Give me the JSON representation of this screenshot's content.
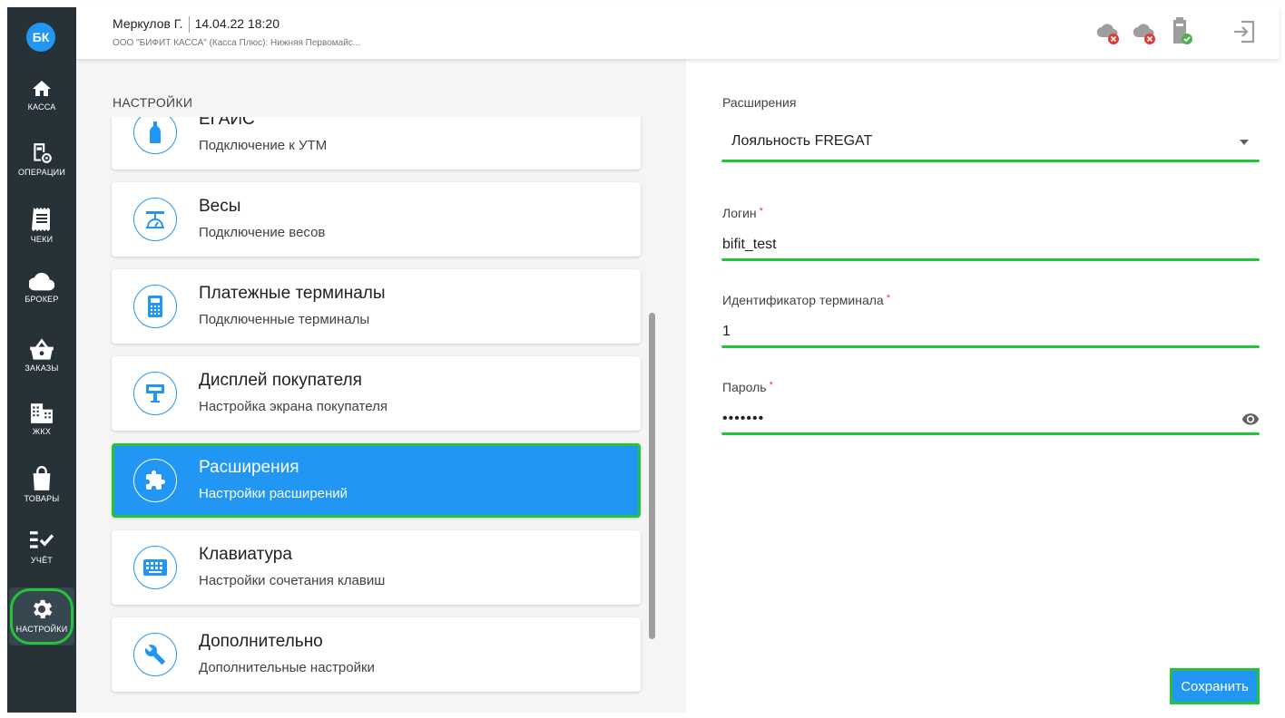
{
  "sidebar": {
    "avatar_initials": "БК",
    "items": [
      {
        "label": "КАССА",
        "icon": "home-icon"
      },
      {
        "label": "ОПЕРАЦИИ",
        "icon": "operations-icon"
      },
      {
        "label": "ЧЕКИ",
        "icon": "receipt-icon"
      },
      {
        "label": "БРОКЕР",
        "icon": "cloud-icon"
      },
      {
        "label": "ЗАКАЗЫ",
        "icon": "basket-icon"
      },
      {
        "label": "ЖКХ",
        "icon": "building-icon"
      },
      {
        "label": "ТОВАРЫ",
        "icon": "shopping-bag-icon"
      },
      {
        "label": "УЧЁТ",
        "icon": "checklist-icon"
      },
      {
        "label": "НАСТРОЙКИ",
        "icon": "gear-icon"
      }
    ],
    "active_item": "НАСТРОЙКИ"
  },
  "header": {
    "user": "Меркулов Г.",
    "datetime": "14.04.22 18:20",
    "org": "ООО \"БИФИТ КАССА\" (Касса Плюс): Нижняя Первомайс...",
    "status_icons": [
      "cloud-error-icon",
      "cloud-error-icon",
      "battery-ok-icon",
      "logout-icon"
    ]
  },
  "settings": {
    "title": "НАСТРОЙКИ",
    "items": [
      {
        "title": "ЕГАИС",
        "subtitle": "Подключение к УТМ",
        "icon": "bottle-icon"
      },
      {
        "title": "Весы",
        "subtitle": "Подключение весов",
        "icon": "scales-icon"
      },
      {
        "title": "Платежные терминалы",
        "subtitle": "Подключенные терминалы",
        "icon": "calculator-icon"
      },
      {
        "title": "Дисплей покупателя",
        "subtitle": "Настройка экрана покупателя",
        "icon": "display-icon"
      },
      {
        "title": "Расширения",
        "subtitle": "Настройки расширений",
        "icon": "puzzle-icon"
      },
      {
        "title": "Клавиатура",
        "subtitle": "Настройки сочетания клавиш",
        "icon": "keyboard-icon"
      },
      {
        "title": "Дополнительно",
        "subtitle": "Дополнительные настройки",
        "icon": "wrench-icon"
      }
    ],
    "selected": "Расширения"
  },
  "form": {
    "extension_label": "Расширения",
    "extension_value": "Лояльность FREGAT",
    "login_label": "Логин",
    "login_value": "bifit_test",
    "terminal_label": "Идентификатор терминала",
    "terminal_value": "1",
    "password_label": "Пароль",
    "password_value": "•••••••",
    "required_mark": "*",
    "save_label": "Сохранить"
  },
  "colors": {
    "sidebar_bg": "#263238",
    "accent": "#2196f3",
    "highlight": "#22c43a",
    "error": "#e53935"
  }
}
